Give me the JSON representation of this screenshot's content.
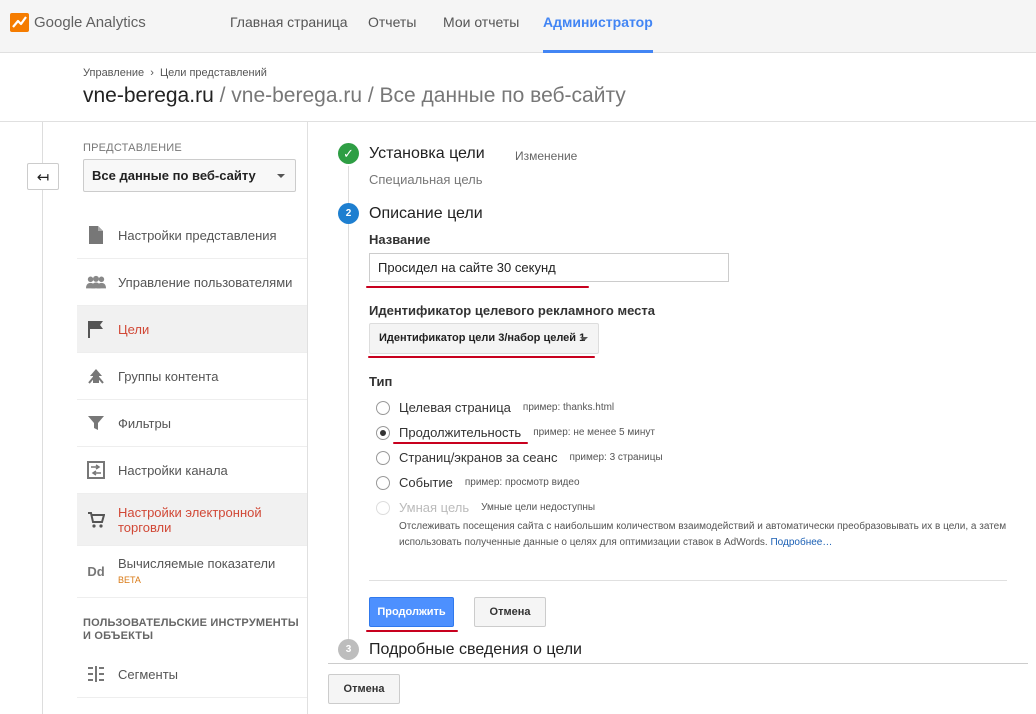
{
  "app": {
    "name": "Google Analytics",
    "brand_color": "#f57c00"
  },
  "nav": [
    {
      "label": "Главная страница"
    },
    {
      "label": "Отчеты"
    },
    {
      "label": "Мои отчеты"
    },
    {
      "label": "Администратор",
      "active": true
    }
  ],
  "breadcrumb": {
    "root": "Управление",
    "separator": "›",
    "current": "Цели представлений"
  },
  "title": {
    "site": "vne-berega.ru",
    "path": "/ vne-berega.ru / Все данные по веб-сайту"
  },
  "sidebar": {
    "view_label": "ПРЕДСТАВЛЕНИЕ",
    "view_value": "Все данные по веб-сайту",
    "back_icon": "↤",
    "items": [
      {
        "label": "Настройки представления",
        "icon": "document-icon"
      },
      {
        "label": "Управление пользователями",
        "icon": "users-icon"
      },
      {
        "label": "Цели",
        "icon": "flag-icon",
        "active": true
      },
      {
        "label": "Группы контента",
        "icon": "content-group-icon"
      },
      {
        "label": "Фильтры",
        "icon": "filter-icon"
      },
      {
        "label": "Настройки канала",
        "icon": "channel-icon"
      },
      {
        "label": "Настройки электронной торговли",
        "icon": "cart-icon",
        "active_red": true
      },
      {
        "label": "Вычисляемые показатели",
        "badge": "BETA",
        "icon": "dd-icon",
        "icon_text": "Dd"
      },
      {
        "label": "Сегменты",
        "icon": "segments-icon"
      }
    ],
    "section_title": "ПОЛЬЗОВАТЕЛЬСКИЕ ИНСТРУМЕНТЫ И ОБЪЕКТЫ"
  },
  "steps": {
    "step1": {
      "title": "Установка цели",
      "edit": "Изменение",
      "sub": "Специальная цель",
      "check": "✓"
    },
    "step2": {
      "num": "2",
      "title": "Описание цели",
      "name_label": "Название",
      "name_value": "Просидел на сайте 30 секунд",
      "slot_label": "Идентификатор целевого рекламного места",
      "slot_value": "Идентификатор цели 3/набор целей 1",
      "type_label": "Тип",
      "types": [
        {
          "label": "Целевая страница",
          "hint": "пример: thanks.html",
          "checked": false
        },
        {
          "label": "Продолжительность",
          "hint": "пример: не менее 5 минут",
          "checked": true
        },
        {
          "label": "Страниц/экранов за сеанс",
          "hint": "пример: 3 страницы",
          "checked": false
        },
        {
          "label": "Событие",
          "hint": "пример: просмотр видео",
          "checked": false
        },
        {
          "label": "Умная цель",
          "hint": "Умные цели недоступны",
          "checked": false,
          "disabled": true
        }
      ],
      "smart_desc": "Отслеживать посещения сайта с наибольшим количеством взаимодействий и автоматически преобразовывать их в цели, а затем использовать полученные данные о целях для оптимизации ставок в AdWords.",
      "smart_link": "Подробнее…",
      "continue": "Продолжить",
      "cancel": "Отмена"
    },
    "step3": {
      "num": "3",
      "title": "Подробные сведения о цели"
    }
  },
  "bottom_cancel": "Отмена",
  "colors": {
    "accent": "#4285f4",
    "active_red": "#d14836",
    "success": "#2e9e44",
    "annotation": "#c8001e"
  }
}
